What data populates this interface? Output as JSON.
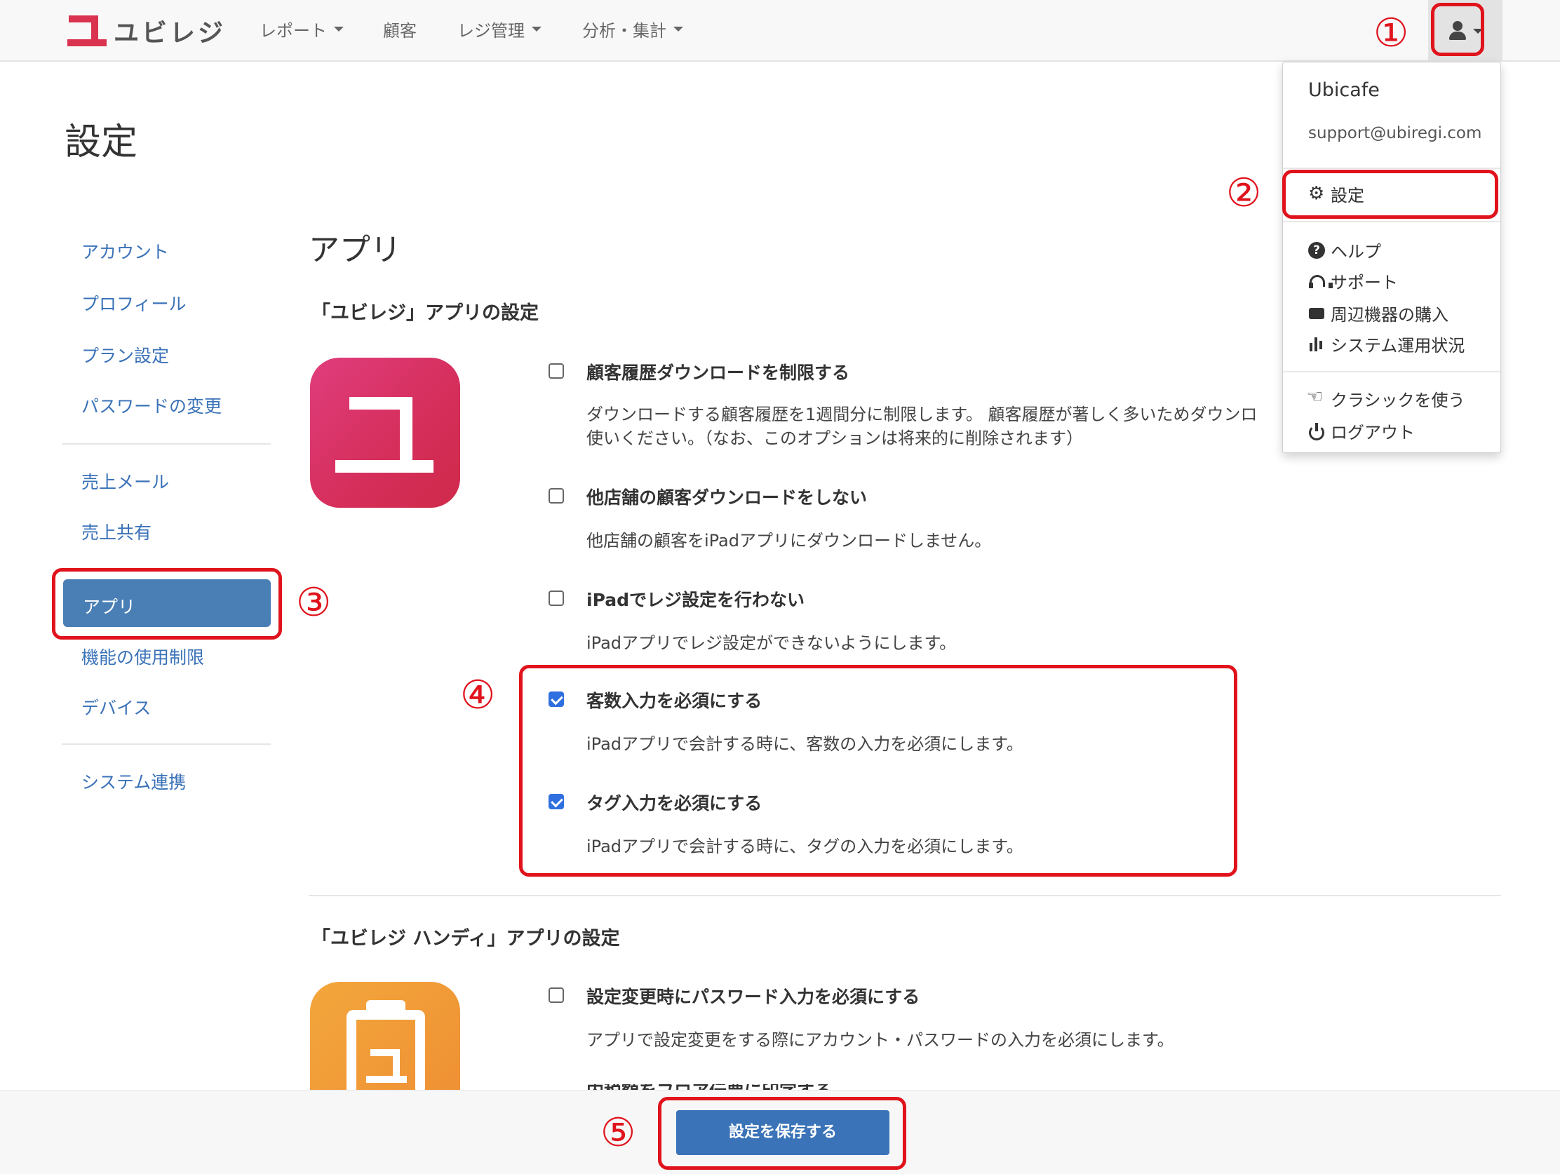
{
  "brand": {
    "name": "ユビレジ"
  },
  "nav": {
    "items": [
      {
        "label": "レポート",
        "dropdown": true
      },
      {
        "label": "顧客",
        "dropdown": false
      },
      {
        "label": "レジ管理",
        "dropdown": true
      },
      {
        "label": "分析・集計",
        "dropdown": true
      }
    ]
  },
  "page": {
    "title": "設定"
  },
  "sidebar": {
    "items": [
      {
        "label": "アカウント"
      },
      {
        "label": "プロフィール"
      },
      {
        "label": "プラン設定"
      },
      {
        "label": "パスワードの変更"
      },
      {
        "label": "売上メール"
      },
      {
        "label": "売上共有"
      },
      {
        "label": "アプリ",
        "active": true
      },
      {
        "label": "機能の使用制限"
      },
      {
        "label": "デバイス"
      },
      {
        "label": "システム連携"
      }
    ]
  },
  "main": {
    "title": "アプリ",
    "ubiregi": {
      "heading": "「ユビレジ」アプリの設定",
      "options": [
        {
          "label": "顧客履歴ダウンロードを制限する",
          "checked": false,
          "desc_line1": "ダウンロードする顧客履歴を1週間分に制限します。 顧客履歴が著しく多いためダウンロ",
          "desc_line2": "使いください。（なお、このオプションは将来的に削除されます）"
        },
        {
          "label": "他店舗の顧客ダウンロードをしない",
          "checked": false,
          "desc": "他店舗の顧客をiPadアプリにダウンロードしません。"
        },
        {
          "label": "iPadでレジ設定を行わない",
          "checked": false,
          "desc": "iPadアプリでレジ設定ができないようにします。"
        },
        {
          "label": "客数入力を必須にする",
          "checked": true,
          "desc": "iPadアプリで会計する時に、客数の入力を必須にします。"
        },
        {
          "label": "タグ入力を必須にする",
          "checked": true,
          "desc": "iPadアプリで会計する時に、タグの入力を必須にします。"
        }
      ]
    },
    "handy": {
      "heading": "「ユビレジ ハンディ」アプリの設定",
      "options": [
        {
          "label": "設定変更時にパスワード入力を必須にする",
          "checked": false,
          "desc": "アプリで設定変更をする際にアカウント・パスワードの入力を必須にします。"
        },
        {
          "label": "内税額をフロア伝票に印字する",
          "checked": false
        }
      ]
    }
  },
  "user_menu": {
    "name": "Ubicafe",
    "email": "support@ubiregi.com",
    "items": [
      {
        "label": "設定",
        "icon": "gear-icon"
      },
      {
        "label": "ヘルプ",
        "icon": "question-circle-icon"
      },
      {
        "label": "サポート",
        "icon": "headphones-icon"
      },
      {
        "label": "周辺機器の購入",
        "icon": "hdd-icon"
      },
      {
        "label": "システム運用状況",
        "icon": "bar-chart-icon"
      },
      {
        "label": "クラシックを使う",
        "icon": "hand-point-icon"
      },
      {
        "label": "ログアウト",
        "icon": "power-icon"
      }
    ]
  },
  "footer": {
    "save_label": "設定を保存する"
  },
  "annotations": [
    "①",
    "②",
    "③",
    "④",
    "⑤"
  ],
  "colors": {
    "accent": "#4a7fb5",
    "link": "#3a72b8",
    "brand": "#d9334f",
    "annotation": "#e0131c",
    "checkbox": "#2f6fe0"
  }
}
